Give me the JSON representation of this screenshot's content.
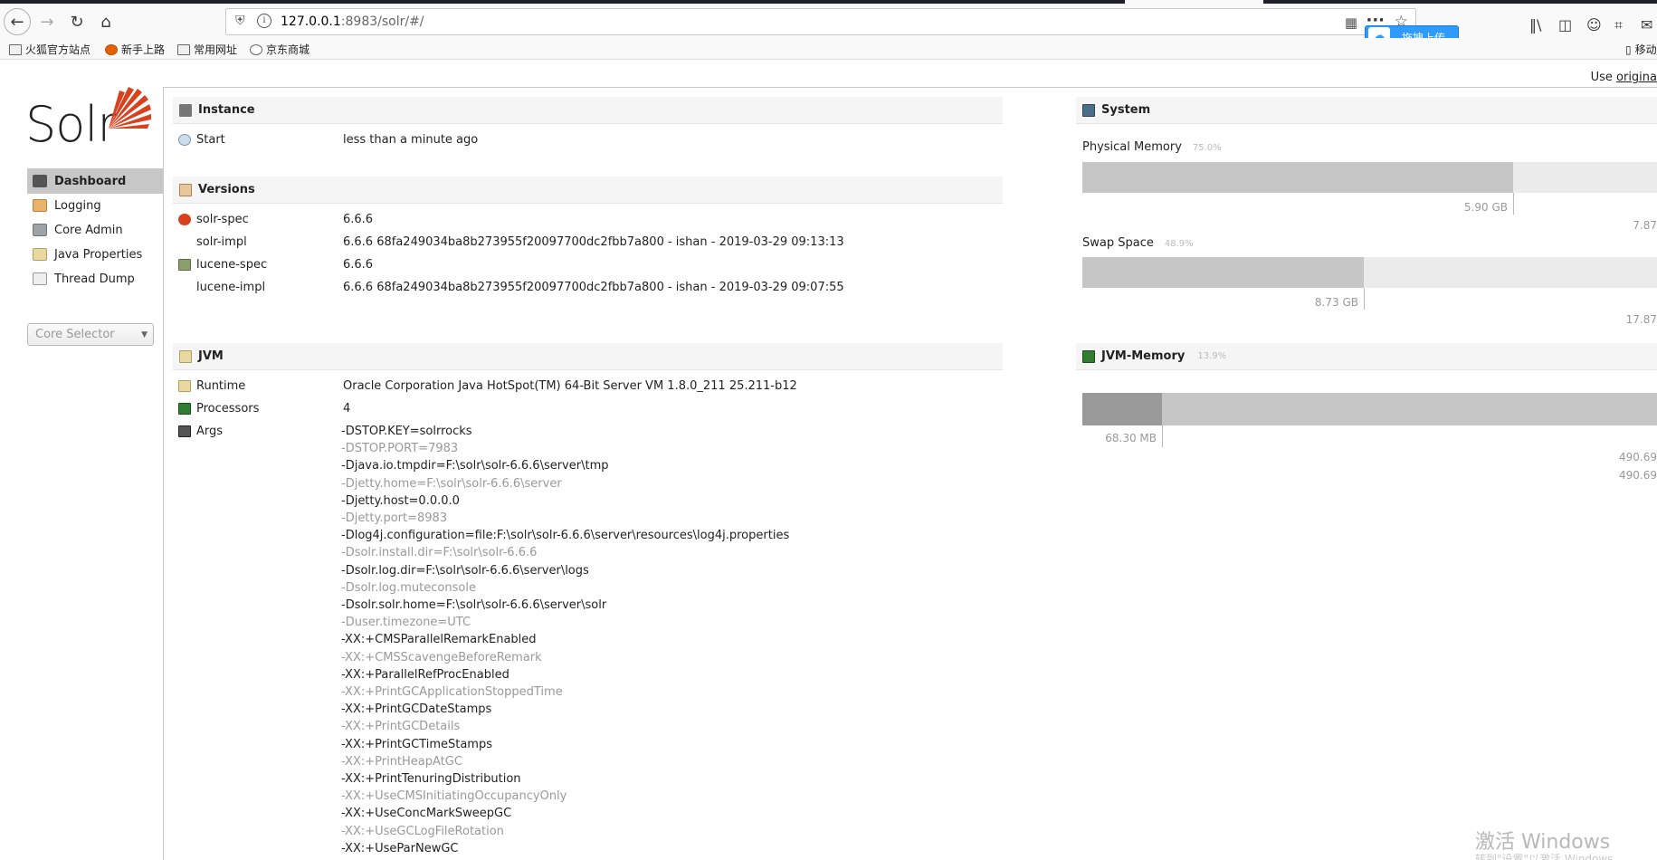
{
  "browser": {
    "url_host": "127.0.0.1",
    "url_rest": ":8983/solr/#/",
    "upload_label": "拖拽上传",
    "bookmarks": [
      "火狐官方站点",
      "新手上路",
      "常用网址",
      "京东商城"
    ],
    "right_partial_label": "移动"
  },
  "header": {
    "use_original_prefix": "Use ",
    "use_original_link": "origina"
  },
  "sidebar": {
    "logo_text": "Solr",
    "items": [
      {
        "label": "Dashboard",
        "active": true
      },
      {
        "label": "Logging"
      },
      {
        "label": "Core Admin"
      },
      {
        "label": "Java Properties"
      },
      {
        "label": "Thread Dump"
      }
    ],
    "core_selector": "Core Selector"
  },
  "instance": {
    "title": "Instance",
    "start_label": "Start",
    "start_value": "less than a minute ago"
  },
  "versions": {
    "title": "Versions",
    "rows": [
      {
        "key": "solr-spec",
        "value": "6.6.6"
      },
      {
        "key": "solr-impl",
        "value": "6.6.6 68fa249034ba8b273955f20097700dc2fbb7a800 - ishan - 2019-03-29 09:13:13"
      },
      {
        "key": "lucene-spec",
        "value": "6.6.6"
      },
      {
        "key": "lucene-impl",
        "value": "6.6.6 68fa249034ba8b273955f20097700dc2fbb7a800 - ishan - 2019-03-29 09:07:55"
      }
    ]
  },
  "jvm": {
    "title": "JVM",
    "runtime_label": "Runtime",
    "runtime_value": "Oracle Corporation Java HotSpot(TM) 64-Bit Server VM 1.8.0_211 25.211-b12",
    "processors_label": "Processors",
    "processors_value": "4",
    "args_label": "Args",
    "args": [
      "-DSTOP.KEY=solrrocks",
      "-DSTOP.PORT=7983",
      "-Djava.io.tmpdir=F:\\solr\\solr-6.6.6\\server\\tmp",
      "-Djetty.home=F:\\solr\\solr-6.6.6\\server",
      "-Djetty.host=0.0.0.0",
      "-Djetty.port=8983",
      "-Dlog4j.configuration=file:F:\\solr\\solr-6.6.6\\server\\resources\\log4j.properties",
      "-Dsolr.install.dir=F:\\solr\\solr-6.6.6",
      "-Dsolr.log.dir=F:\\solr\\solr-6.6.6\\server\\logs",
      "-Dsolr.log.muteconsole",
      "-Dsolr.solr.home=F:\\solr\\solr-6.6.6\\server\\solr",
      "-Duser.timezone=UTC",
      "-XX:+CMSParallelRemarkEnabled",
      "-XX:+CMSScavengeBeforeRemark",
      "-XX:+ParallelRefProcEnabled",
      "-XX:+PrintGCApplicationStoppedTime",
      "-XX:+PrintGCDateStamps",
      "-XX:+PrintGCDetails",
      "-XX:+PrintGCTimeStamps",
      "-XX:+PrintHeapAtGC",
      "-XX:+PrintTenuringDistribution",
      "-XX:+UseCMSInitiatingOccupancyOnly",
      "-XX:+UseConcMarkSweepGC",
      "-XX:+UseGCLogFileRotation",
      "-XX:+UseParNewGC"
    ]
  },
  "system": {
    "title": "System",
    "physical_label": "Physical Memory",
    "physical_pct": "75.0%",
    "physical_fraction": 0.75,
    "physical_used": "5.90 GB",
    "physical_total": "7.87",
    "swap_label": "Swap Space",
    "swap_pct": "48.9%",
    "swap_fraction": 0.489,
    "swap_used": "8.73 GB",
    "swap_total": "17.87"
  },
  "jvm_memory": {
    "title": "JVM-Memory",
    "pct": "13.9%",
    "used_fraction": 0.139,
    "used": "68.30 MB",
    "committed": "490.69",
    "max": "490.69"
  },
  "watermark": {
    "line1": "激活 Windows",
    "line2": "转到\"设置\"以激活 Windows。"
  },
  "colors": {
    "solr_orange": "#d9411e",
    "sidebar_active": "#c7c7c7"
  }
}
